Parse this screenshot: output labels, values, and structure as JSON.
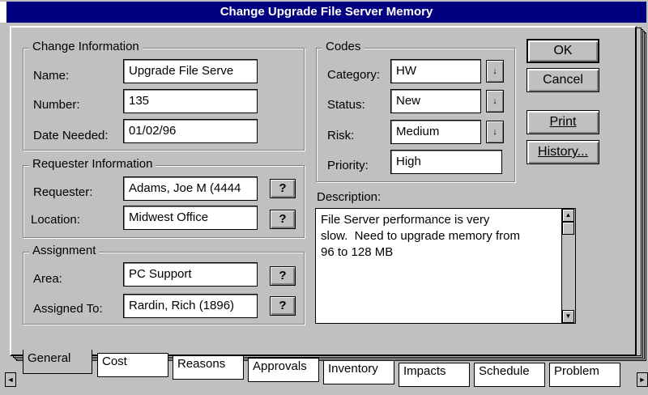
{
  "window": {
    "title": "Change Upgrade File Server Memory"
  },
  "change_info": {
    "title": "Change Information",
    "name_label": "Name:",
    "name_value": "Upgrade File Serve",
    "number_label": "Number:",
    "number_value": "135",
    "date_label": "Date Needed:",
    "date_value": "01/02/96"
  },
  "requester_info": {
    "title": "Requester Information",
    "requester_label": "Requester:",
    "requester_value": "Adams, Joe M (4444",
    "location_label": "Location:",
    "location_value": "Midwest Office",
    "lookup": "?"
  },
  "assignment": {
    "title": "Assignment",
    "area_label": "Area:",
    "area_value": "PC Support",
    "assigned_label": "Assigned To:",
    "assigned_value": "Rardin, Rich (1896)",
    "lookup": "?"
  },
  "codes": {
    "title": "Codes",
    "category_label": "Category:",
    "category_value": "HW",
    "status_label": "Status:",
    "status_value": "New",
    "risk_label": "Risk:",
    "risk_value": "Medium",
    "priority_label": "Priority:",
    "priority_value": "High",
    "dropdown_glyph": "↓"
  },
  "buttons": {
    "ok": "OK",
    "cancel": "Cancel",
    "print": "Print",
    "history": "History..."
  },
  "description": {
    "label": "Description:",
    "text": "File Server performance is very\nslow.  Need to upgrade memory from\n96 to 128 MB"
  },
  "tabs": [
    {
      "label": "General"
    },
    {
      "label": "Cost"
    },
    {
      "label": "Reasons"
    },
    {
      "label": "Approvals"
    },
    {
      "label": "Inventory"
    },
    {
      "label": "Impacts"
    },
    {
      "label": "Schedule"
    },
    {
      "label": "Problem"
    }
  ],
  "scroll": {
    "left": "◄",
    "right": "►",
    "up": "▲",
    "down": "▼"
  }
}
